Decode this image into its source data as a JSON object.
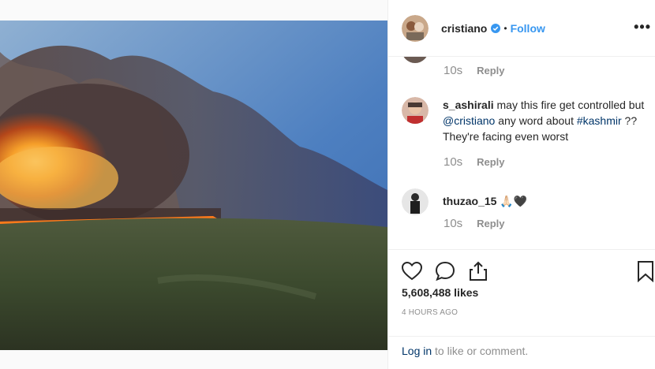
{
  "post": {
    "photo_icon": "wildfire-photo",
    "author": {
      "username": "cristiano",
      "verified_icon": "verified-badge-icon",
      "separator": "•",
      "follow_label": "Follow",
      "more_icon": "more-options-icon",
      "more_glyph": "•••"
    }
  },
  "comments": {
    "previous": {
      "time": "10s",
      "reply_label": "Reply"
    },
    "items": [
      {
        "username": "s_ashirali",
        "text_before": "may this fire get controlled but",
        "mention": "@cristiano",
        "text_middle": "any word about",
        "hashtag": "#kashmir",
        "text_after": "?? They're facing even worst",
        "time": "10s",
        "reply_label": "Reply"
      },
      {
        "username": "thuzao_15",
        "text": "🙏🏻🖤",
        "time": "10s",
        "reply_label": "Reply"
      }
    ]
  },
  "actions": {
    "like_icon": "heart-icon",
    "comment_icon": "comment-icon",
    "share_icon": "share-icon",
    "save_icon": "bookmark-icon",
    "likes": "5,608,488 likes",
    "time_ago": "4 HOURS AGO"
  },
  "footer": {
    "login_link": "Log in",
    "login_text": "to like or comment."
  },
  "colors": {
    "accent": "#3897f0",
    "link": "#003569",
    "muted": "#8e8e8e"
  }
}
